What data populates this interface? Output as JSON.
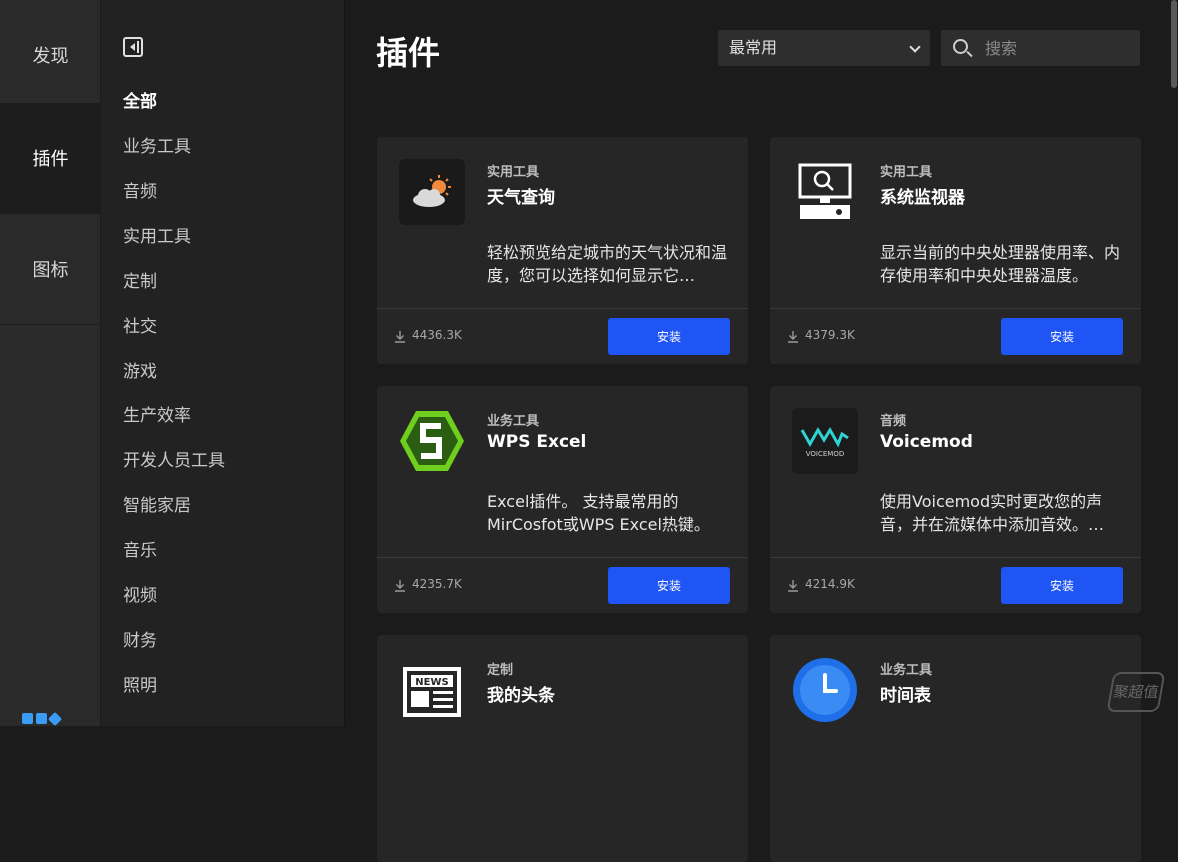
{
  "rail": {
    "items": [
      {
        "label": "发现",
        "active": false
      },
      {
        "label": "插件",
        "active": true
      },
      {
        "label": "图标",
        "active": false
      }
    ]
  },
  "categories": {
    "items": [
      "全部",
      "业务工具",
      "音频",
      "实用工具",
      "定制",
      "社交",
      "游戏",
      "生产效率",
      "开发人员工具",
      "智能家居",
      "音乐",
      "视频",
      "财务",
      "照明"
    ],
    "active_index": 0
  },
  "header": {
    "title": "插件",
    "sort_value": "最常用",
    "search_placeholder": "搜索"
  },
  "cards": [
    {
      "category": "实用工具",
      "name": "天气查询",
      "desc": "轻松预览给定城市的天气状况和温度，您可以选择如何显示它…",
      "downloads": "4436.3K",
      "button": "安装",
      "icon": "weather-icon"
    },
    {
      "category": "实用工具",
      "name": "系统监视器",
      "desc": "显示当前的中央处理器使用率、内存使用率和中央处理器温度。",
      "downloads": "4379.3K",
      "button": "安装",
      "icon": "monitor-icon"
    },
    {
      "category": "业务工具",
      "name": "WPS Excel",
      "desc": "Excel插件。 支持最常用的MirCosfot或WPS Excel热键。",
      "downloads": "4235.7K",
      "button": "安装",
      "icon": "wps-excel-icon"
    },
    {
      "category": "音频",
      "name": "Voicemod",
      "desc": "使用Voicemod实时更改您的声音，并在流媒体中添加音效。…",
      "downloads": "4214.9K",
      "button": "安装",
      "icon": "voicemod-icon"
    },
    {
      "category": "定制",
      "name": "我的头条",
      "desc": "",
      "downloads": "",
      "button": "",
      "icon": "news-icon"
    },
    {
      "category": "业务工具",
      "name": "时间表",
      "desc": "",
      "downloads": "",
      "button": "",
      "icon": "clock-icon"
    }
  ],
  "logos": {
    "voicemod_text": "VOICEMOD",
    "news_text": "NEWS"
  },
  "watermark": "聚超值"
}
